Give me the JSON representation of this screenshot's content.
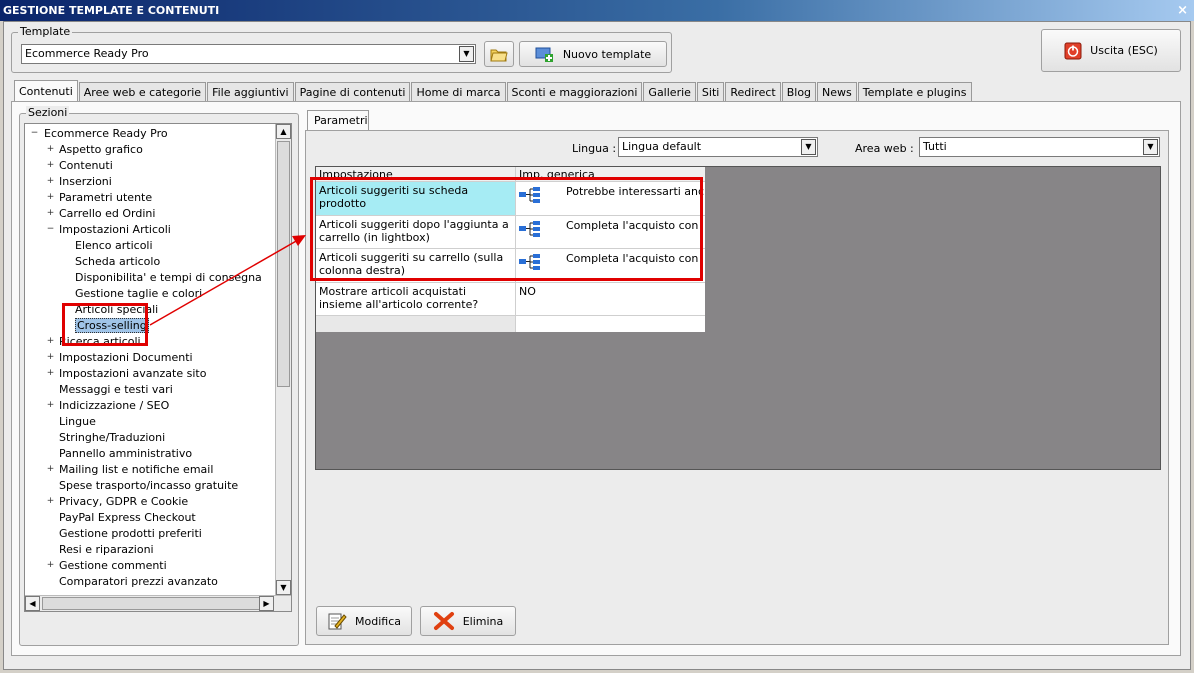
{
  "window": {
    "title": "GESTIONE TEMPLATE E CONTENUTI",
    "close_glyph": "×"
  },
  "template_group": {
    "label": "Template",
    "selected": "Ecommerce Ready Pro"
  },
  "buttons": {
    "new_template": "Nuovo template",
    "exit": "Uscita (ESC)",
    "modify": "Modifica",
    "delete": "Elimina"
  },
  "tabs": [
    "Contenuti",
    "Aree web e categorie",
    "File aggiuntivi",
    "Pagine di contenuti",
    "Home di marca",
    "Sconti e maggiorazioni",
    "Gallerie",
    "Siti",
    "Redirect",
    "Blog",
    "News",
    "Template e plugins"
  ],
  "sections": {
    "label": "Sezioni",
    "tree": [
      {
        "label": "Ecommerce Ready Pro",
        "level": 0,
        "expander": "−"
      },
      {
        "label": "Aspetto grafico",
        "level": 1,
        "expander": "+"
      },
      {
        "label": "Contenuti",
        "level": 1,
        "expander": "+"
      },
      {
        "label": "Inserzioni",
        "level": 1,
        "expander": "+"
      },
      {
        "label": "Parametri utente",
        "level": 1,
        "expander": "+"
      },
      {
        "label": "Carrello ed Ordini",
        "level": 1,
        "expander": "+"
      },
      {
        "label": "Impostazioni Articoli",
        "level": 1,
        "expander": "−"
      },
      {
        "label": "Elenco articoli",
        "level": 2,
        "expander": ""
      },
      {
        "label": "Scheda articolo",
        "level": 2,
        "expander": ""
      },
      {
        "label": "Disponibilita' e tempi di consegna",
        "level": 2,
        "expander": ""
      },
      {
        "label": "Gestione taglie e colori",
        "level": 2,
        "expander": ""
      },
      {
        "label": "Articoli speciali",
        "level": 2,
        "expander": ""
      },
      {
        "label": "Cross-selling",
        "level": 2,
        "expander": "",
        "selected": true
      },
      {
        "label": "Ricerca articoli",
        "level": 1,
        "expander": "+"
      },
      {
        "label": "Impostazioni Documenti",
        "level": 1,
        "expander": "+"
      },
      {
        "label": "Impostazioni avanzate sito",
        "level": 1,
        "expander": "+"
      },
      {
        "label": "Messaggi e testi vari",
        "level": 1,
        "expander": ""
      },
      {
        "label": "Indicizzazione / SEO",
        "level": 1,
        "expander": "+"
      },
      {
        "label": "Lingue",
        "level": 1,
        "expander": ""
      },
      {
        "label": "Stringhe/Traduzioni",
        "level": 1,
        "expander": ""
      },
      {
        "label": "Pannello amministrativo",
        "level": 1,
        "expander": ""
      },
      {
        "label": "Mailing list e notifiche email",
        "level": 1,
        "expander": "+"
      },
      {
        "label": "Spese trasporto/incasso gratuite",
        "level": 1,
        "expander": ""
      },
      {
        "label": "Privacy, GDPR e Cookie",
        "level": 1,
        "expander": "+"
      },
      {
        "label": "PayPal Express Checkout",
        "level": 1,
        "expander": ""
      },
      {
        "label": "Gestione prodotti preferiti",
        "level": 1,
        "expander": ""
      },
      {
        "label": "Resi e riparazioni",
        "level": 1,
        "expander": ""
      },
      {
        "label": "Gestione commenti",
        "level": 1,
        "expander": "+"
      },
      {
        "label": "Comparatori prezzi avanzato",
        "level": 1,
        "expander": ""
      }
    ]
  },
  "params": {
    "tab_label": "Parametri",
    "language_label": "Lingua :",
    "language_value": "Lingua default",
    "area_label": "Area web :",
    "area_value": "Tutti",
    "columns": [
      "Impostazione",
      "Imp. generica"
    ],
    "rows": [
      {
        "setting": "Articoli suggeriti su scheda prodotto",
        "value": "Potrebbe interessarti anche",
        "icon": true
      },
      {
        "setting": "Articoli suggeriti dopo l'aggiunta a carrello (in lightbox)",
        "value": "Completa l'acquisto con",
        "icon": true
      },
      {
        "setting": "Articoli suggeriti su carrello (sulla colonna destra)",
        "value": "Completa l'acquisto con",
        "icon": true
      },
      {
        "setting": "Mostrare articoli acquistati insieme all'articolo corrente?",
        "value": "NO",
        "icon": false
      },
      {
        "setting": "",
        "value": "",
        "icon": false
      }
    ]
  },
  "colors": {
    "highlight": "#e00000",
    "selection": "#a0c4e8",
    "title_bar": "#0a246a"
  }
}
